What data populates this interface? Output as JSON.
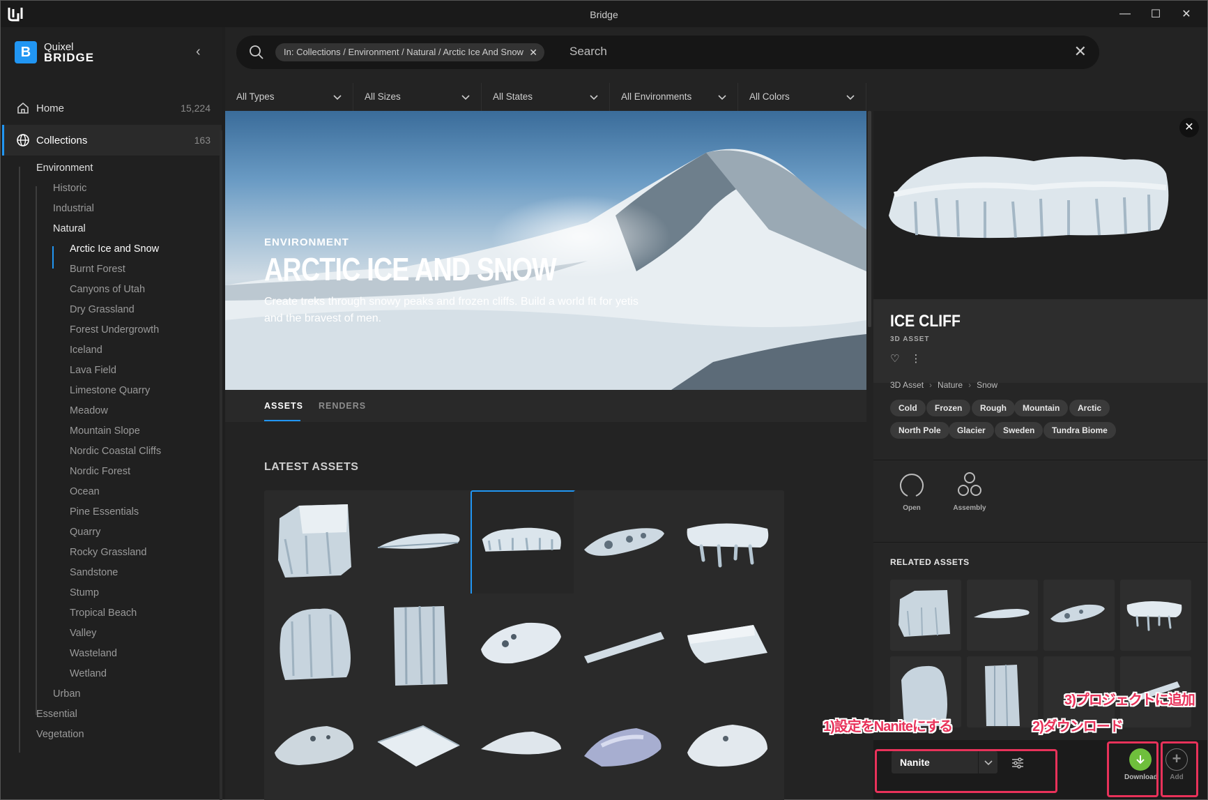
{
  "window": {
    "title": "Bridge"
  },
  "brand": {
    "line1": "Quixel",
    "line2": "BRIDGE"
  },
  "nav": {
    "home": {
      "label": "Home",
      "count": "15,224"
    },
    "collections": {
      "label": "Collections",
      "count": "163"
    }
  },
  "tree": {
    "environment": "Environment",
    "historic": "Historic",
    "industrial": "Industrial",
    "natural": "Natural",
    "natural_items": [
      "Arctic Ice and Snow",
      "Burnt Forest",
      "Canyons of Utah",
      "Dry Grassland",
      "Forest Undergrowth",
      "Iceland",
      "Lava Field",
      "Limestone Quarry",
      "Meadow",
      "Mountain Slope",
      "Nordic Coastal Cliffs",
      "Nordic Forest",
      "Ocean",
      "Pine Essentials",
      "Quarry",
      "Rocky Grassland",
      "Sandstone",
      "Stump",
      "Tropical Beach",
      "Valley",
      "Wasteland",
      "Wetland"
    ],
    "urban": "Urban",
    "essential": "Essential",
    "vegetation": "Vegetation"
  },
  "search": {
    "chip": "In: Collections / Environment / Natural / Arctic Ice And Snow",
    "placeholder": "Search"
  },
  "filters": [
    "All Types",
    "All Sizes",
    "All States",
    "All Environments",
    "All Colors"
  ],
  "hero": {
    "tag": "ENVIRONMENT",
    "title": "ARCTIC ICE AND SNOW",
    "description": "Create treks through snowy peaks and frozen cliffs. Build a world fit for yetis and the bravest of men."
  },
  "tabs": {
    "assets": "ASSETS",
    "renders": "RENDERS"
  },
  "latest_assets": "LATEST ASSETS",
  "detail": {
    "title": "ICE CLIFF",
    "subtitle": "3D ASSET",
    "breadcrumb": [
      "3D Asset",
      "Nature",
      "Snow"
    ],
    "tags": [
      "Cold",
      "Frozen",
      "Rough",
      "Mountain",
      "Arctic",
      "North Pole",
      "Glacier",
      "Sweden",
      "Tundra Biome"
    ],
    "tools": {
      "open": "Open",
      "assembly": "Assembly"
    },
    "related": "RELATED ASSETS",
    "quality": "Nanite",
    "download": "Download",
    "add": "Add"
  },
  "annotations": {
    "step1": "1)設定をNaniteにする",
    "step2": "2)ダウンロード",
    "step3": "3)プロジェクトに追加"
  },
  "colors": {
    "accent": "#2196f3",
    "annotation": "#e8325a",
    "download": "#6fbf3c"
  }
}
